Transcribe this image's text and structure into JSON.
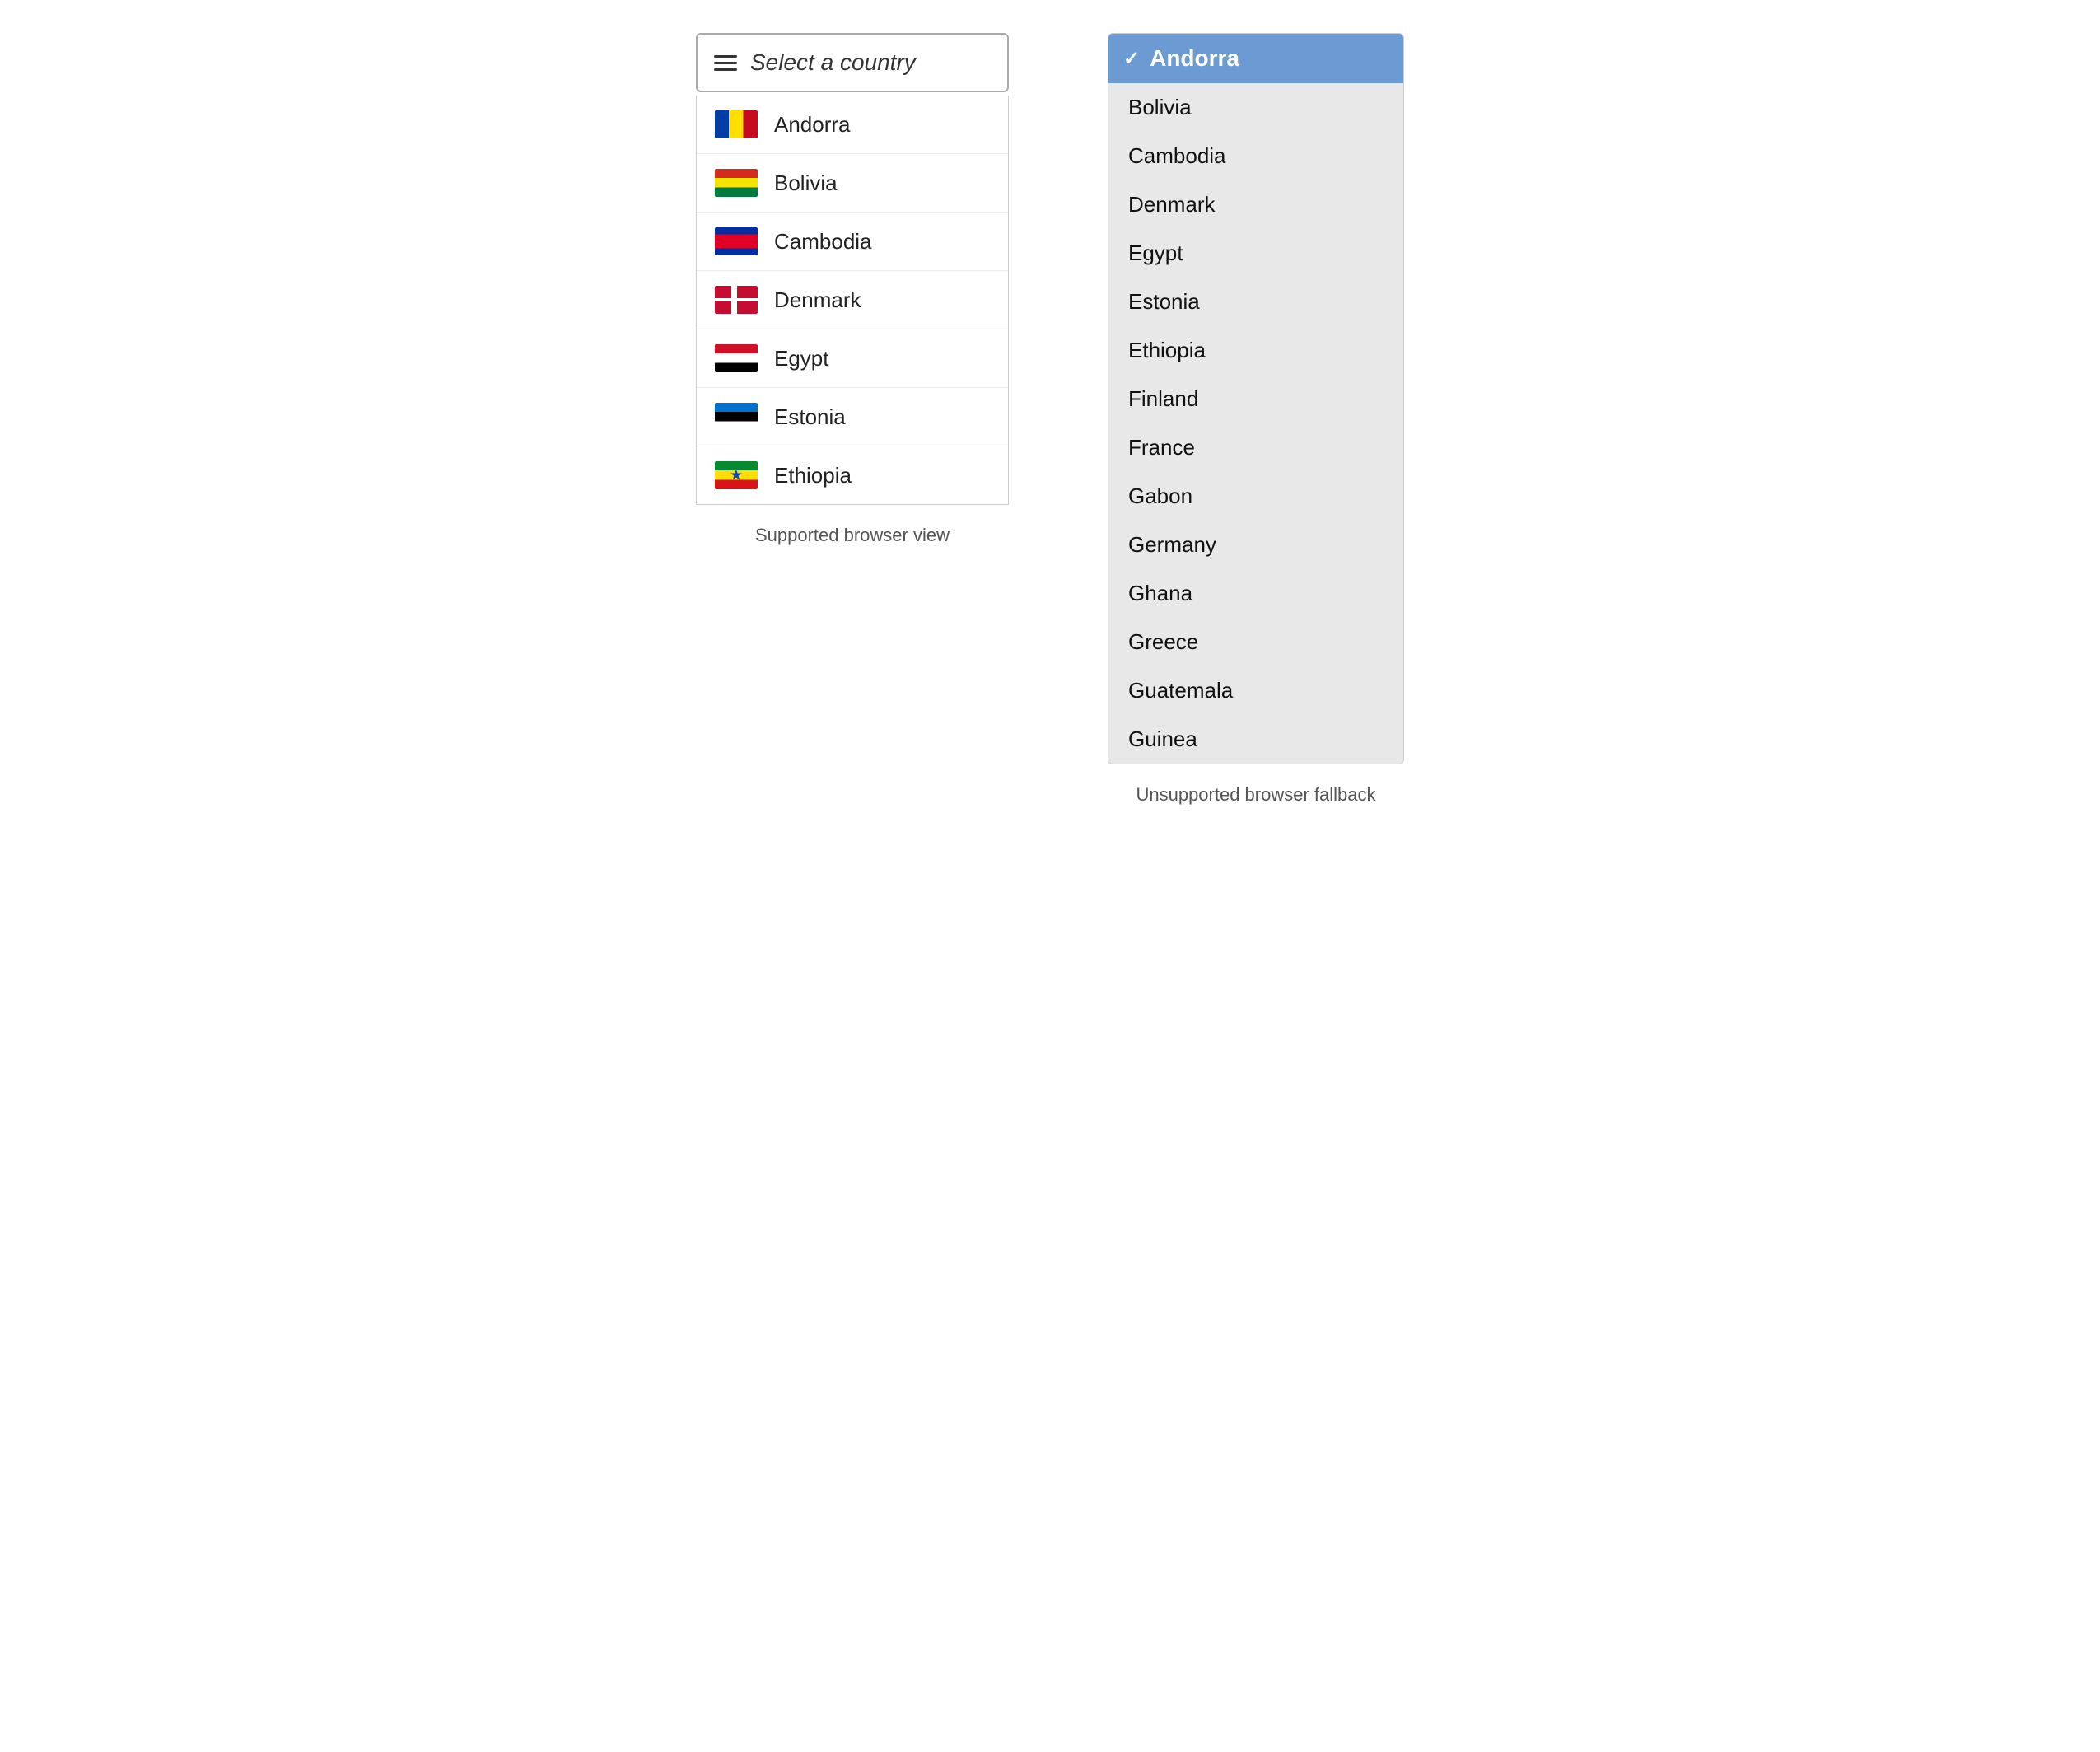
{
  "left": {
    "trigger_label": "Select a country",
    "caption": "Supported browser view",
    "items": [
      {
        "name": "Andorra",
        "flag_class": "flag-andorra"
      },
      {
        "name": "Bolivia",
        "flag_class": "flag-bolivia"
      },
      {
        "name": "Cambodia",
        "flag_class": "flag-cambodia"
      },
      {
        "name": "Denmark",
        "flag_class": "flag-denmark"
      },
      {
        "name": "Egypt",
        "flag_class": "flag-egypt"
      },
      {
        "name": "Estonia",
        "flag_class": "flag-estonia"
      },
      {
        "name": "Ethiopia",
        "flag_class": "flag-ethiopia"
      }
    ]
  },
  "right": {
    "caption": "Unsupported browser fallback",
    "selected": "Andorra",
    "checkmark": "✓",
    "items": [
      "Andorra",
      "Bolivia",
      "Cambodia",
      "Denmark",
      "Egypt",
      "Estonia",
      "Ethiopia",
      "Finland",
      "France",
      "Gabon",
      "Germany",
      "Ghana",
      "Greece",
      "Guatemala",
      "Guinea"
    ]
  }
}
